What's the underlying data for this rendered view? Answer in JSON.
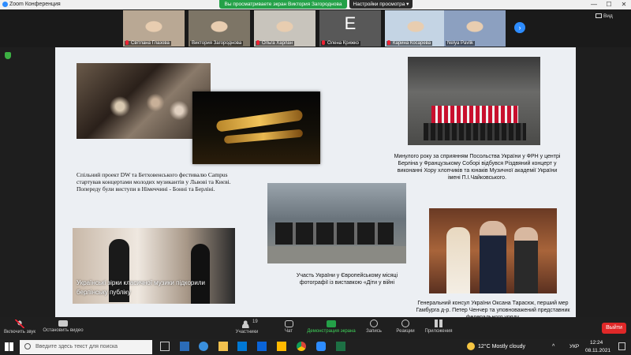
{
  "window": {
    "title": "Zoom Конференция",
    "minimize": "—",
    "maximize": "☐",
    "close": "✕"
  },
  "share_banner": {
    "text": "Вы просматриваете экран Виктория Загороднова",
    "settings_label": "Настройки просмотра ▾"
  },
  "gallery": {
    "participants": [
      {
        "name": "Світлана Глазова",
        "muted": true,
        "bg": "#b9a894"
      },
      {
        "name": "Виктория Загороднова",
        "muted": false,
        "bg": "#7d7566"
      },
      {
        "name": "Ольга Харлан",
        "muted": true,
        "bg": "#c8c4bc"
      },
      {
        "name": "Олена Крижко",
        "muted": true,
        "letter": "E",
        "bg": "#585858"
      },
      {
        "name": "Карина Косарева",
        "muted": true,
        "bg": "#c4d4e4"
      },
      {
        "name": "Nelya Pavlik",
        "muted": false,
        "bg": "#8ca0c0"
      }
    ],
    "view_label": "Вид"
  },
  "slide": {
    "caption_dw": "Спільний проект DW та Бетховенського фестивалю Campus стартував концертами молодих музикантів у Львові та Києві. Попереду були виступи в Німеччині - Бонні та Берліні.",
    "caption_choir": "Минулого року за сприянням Посольства України у ФРН у центрі Берліна у Французькому Соборі відбувся Різдвяний концерт у виконанні Хору хлопчиків та юнаків Музичної академії України імені П.І.Чайковського.",
    "caption_stars": "Українські зірки класичної музики підкорили берлінську публіку",
    "caption_exhibit": "Участь України у Європейському місяці фотографії із виставкою «Діти у війні",
    "caption_consul": "Генеральний консул України Оксана Тарасюк, перший мер Гамбурга д-р. Петер Ченчер та уповноважений представник федерального уряду,"
  },
  "toolbar": {
    "mute": "Включить звук",
    "video": "Остановить видео",
    "participants": "Участники",
    "participants_count": "19",
    "chat": "Чат",
    "share": "Демонстрация экрана",
    "record": "Запись",
    "reactions": "Реакции",
    "apps": "Приложения",
    "leave": "Выйти"
  },
  "taskbar": {
    "search_placeholder": "Введите здесь текст для поиска",
    "weather": "12°C Mostly cloudy",
    "lang": "УКР",
    "time": "12:24",
    "date": "08.11.2021"
  },
  "colors": {
    "accent": "#2d8cff",
    "share_green": "#24a148",
    "leave_red": "#e02828"
  }
}
